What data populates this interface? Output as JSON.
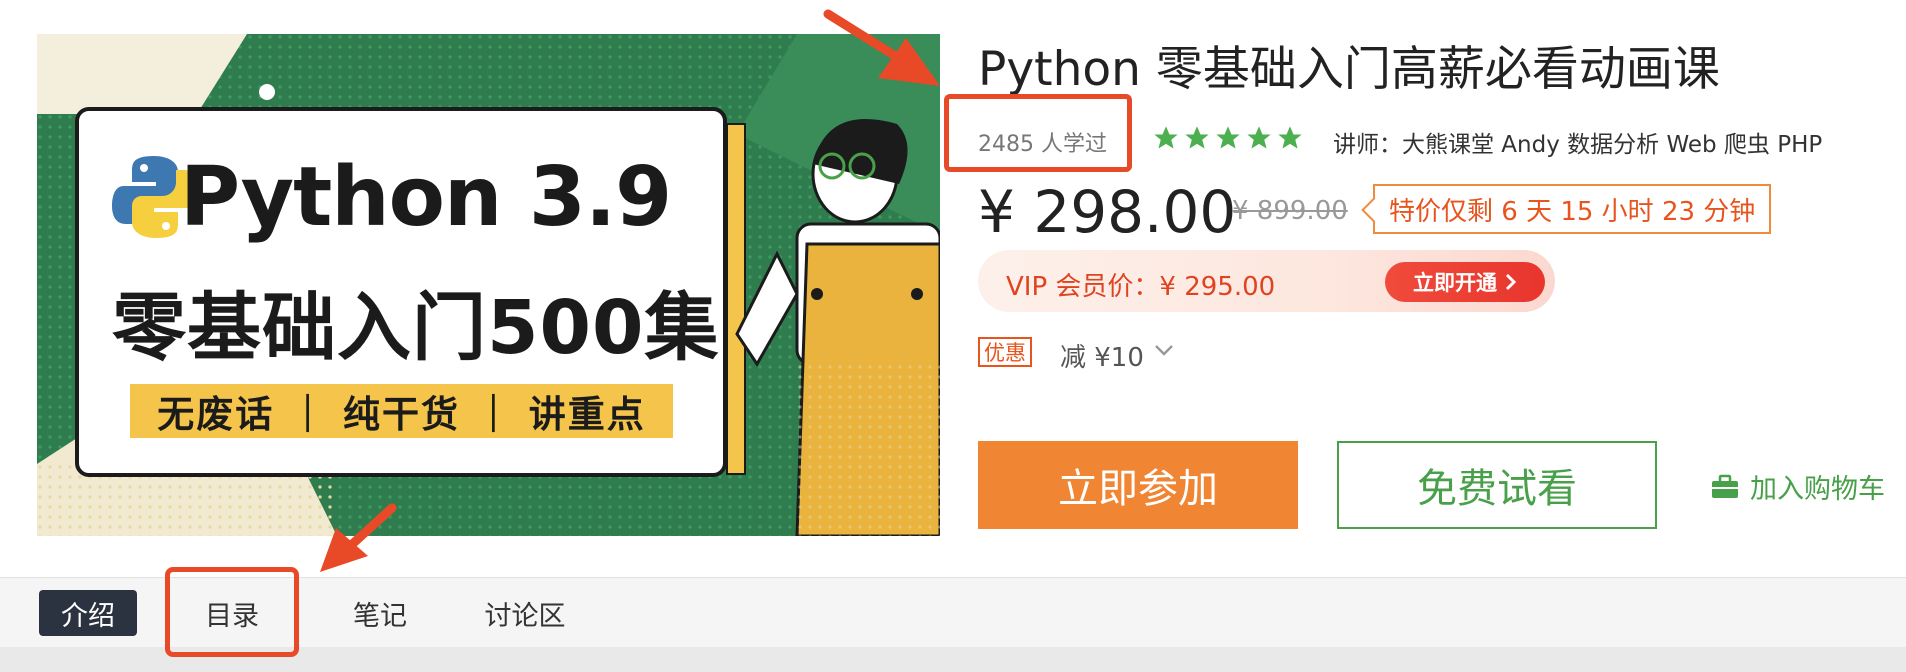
{
  "cover": {
    "python_title": "Python 3.9",
    "cn_title": "零基础入门500集",
    "tagline": "无废话 ｜ 纯干货 ｜ 讲重点"
  },
  "course": {
    "title": "Python 零基础入门高薪必看动画课",
    "learners": "2485 人学过",
    "rating_stars": 5,
    "lecturer": "讲师：大熊课堂 Andy 数据分析 Web 爬虫 PHP",
    "price": "¥ 298.00",
    "original_price": "¥ 899.00",
    "countdown": "特价仅剩 6 天 15 小时 23 分钟",
    "vip_price": "VIP 会员价：¥ 295.00",
    "vip_button": "立即开通",
    "coupon_tag": "优惠",
    "coupon_text": "减 ¥10"
  },
  "actions": {
    "join": "立即参加",
    "trial": "免费试看",
    "cart": "加入购物车"
  },
  "tabs": [
    {
      "label": "介绍",
      "active": true
    },
    {
      "label": "目录",
      "active": false
    },
    {
      "label": "笔记",
      "active": false
    },
    {
      "label": "讨论区",
      "active": false
    }
  ],
  "colors": {
    "accent_orange": "#f08533",
    "accent_green": "#49a04a",
    "price_red": "#e0431f",
    "annotation_red": "#e84a27"
  }
}
